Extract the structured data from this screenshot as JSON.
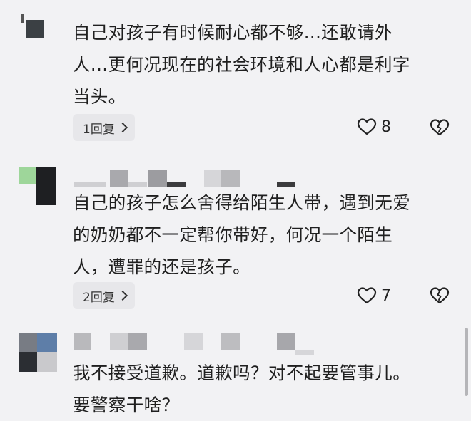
{
  "comments": [
    {
      "text": "自己对孩子有时候耐心都不够...还敢请外\n人...更何况现在的社会环境和人心都是利字\n当头。",
      "reply_label": "1回复",
      "likes": "8"
    },
    {
      "text": "自己的孩子怎么舍得给陌生人带，遇到无爱\n的奶奶都不一定帮你带好，何况一个陌生\n人，遭罪的还是孩子。",
      "reply_label": "2回复",
      "likes": "7"
    },
    {
      "text": "我不接受道歉。道歉吗？对不起要管事儿。\n要警察干啥？"
    }
  ],
  "icons": {
    "like": "heart-outline-icon",
    "dislike": "broken-heart-icon",
    "reply_chevron": "chevron-right-icon"
  },
  "colors": {
    "background": "#f2f2f4",
    "reply_bg": "#e7e7ea",
    "text": "#1f1f1f"
  }
}
